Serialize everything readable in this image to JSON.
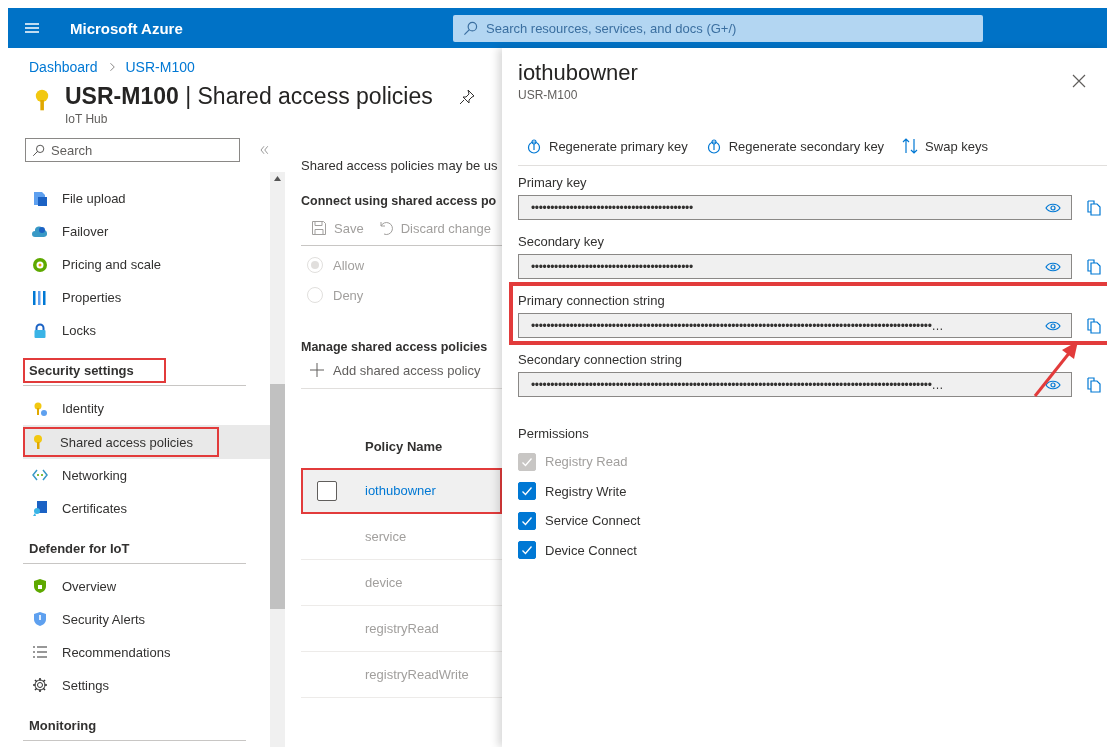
{
  "topbar": {
    "title": "Microsoft Azure",
    "search": {
      "placeholder": "Search resources, services, and docs (G+/)"
    }
  },
  "breadcrumb": [
    "Dashboard",
    "USR-M100"
  ],
  "page": {
    "title": "**USR-M100** | Shared access policies",
    "subtitle": "IoT Hub"
  },
  "sidebar": {
    "search": {
      "placeholder": "Search"
    },
    "groups": [
      {
        "items": [
          {
            "label": "File upload",
            "selected": false
          },
          {
            "label": "Failover",
            "selected": false
          },
          {
            "label": "Pricing and scale",
            "selected": false
          },
          {
            "label": "Properties",
            "selected": false
          },
          {
            "label": "Locks",
            "selected": false
          }
        ]
      },
      {
        "title": "Security settings",
        "highlighted": true,
        "items": [
          {
            "label": "Identity",
            "selected": false,
            "highlighted": false
          },
          {
            "label": "Shared access policies",
            "selected": true,
            "highlighted": true
          },
          {
            "label": "Networking",
            "selected": false,
            "highlighted": false
          },
          {
            "label": "Certificates",
            "selected": false,
            "highlighted": false
          }
        ]
      },
      {
        "title": "Defender for IoT",
        "highlighted": false,
        "items": [
          {
            "label": "Overview",
            "selected": false
          },
          {
            "label": "Security Alerts",
            "selected": false
          },
          {
            "label": "Recommendations",
            "selected": false
          },
          {
            "label": "Settings",
            "selected": false
          }
        ]
      },
      {
        "title": "Monitoring",
        "highlighted": false
      }
    ]
  },
  "content": {
    "description": "Shared access policies may be us",
    "connect_heading": "Connect using shared access po",
    "toolbar": [
      {
        "label": "Save",
        "disabled": true
      },
      {
        "label": "Discard change",
        "disabled": true
      }
    ],
    "radios": [
      {
        "label": "Allow",
        "selected": true
      },
      {
        "label": "Deny",
        "selected": false
      }
    ],
    "manage_heading": "Manage shared access policies",
    "add_button": "Add shared access policy",
    "table": {
      "columns": [
        "Policy Name"
      ],
      "rows": [
        {
          "name": "iothubowner",
          "selected": true,
          "highlighted": true
        },
        {
          "name": "service",
          "selected": false,
          "highlighted": false
        },
        {
          "name": "device",
          "selected": false,
          "highlighted": false
        },
        {
          "name": "registryRead",
          "selected": false,
          "highlighted": false
        },
        {
          "name": "registryReadWrite",
          "selected": false,
          "highlighted": false
        }
      ]
    }
  },
  "blade": {
    "title": "iothubowner",
    "subtitle": "USR-M100",
    "toolbar": [
      "Regenerate primary key",
      "Regenerate secondary key",
      "Swap keys"
    ],
    "fields": [
      {
        "label": "Primary key",
        "value": "••••••••••••••••••••••••••••••••••••••••••",
        "highlighted": false
      },
      {
        "label": "Secondary key",
        "value": "••••••••••••••••••••••••••••••••••••••••••",
        "highlighted": false
      },
      {
        "label": "Primary connection string",
        "value": "••••••••••••••••••••••••••••••••••••••••••••••••••••••••••••••••••••••••••••••••••••••••••••••••••••••••…",
        "highlighted": true
      },
      {
        "label": "Secondary connection string",
        "value": "••••••••••••••••••••••••••••••••••••••••••••••••••••••••••••••••••••••••••••••••••••••••••••••••••••••••…",
        "highlighted": false
      }
    ],
    "permissions_title": "Permissions",
    "permissions": [
      {
        "label": "Registry Read",
        "checked": true,
        "disabled": true
      },
      {
        "label": "Registry Write",
        "checked": true,
        "disabled": false
      },
      {
        "label": "Service Connect",
        "checked": true,
        "disabled": false
      },
      {
        "label": "Device Connect",
        "checked": true,
        "disabled": false
      }
    ]
  }
}
